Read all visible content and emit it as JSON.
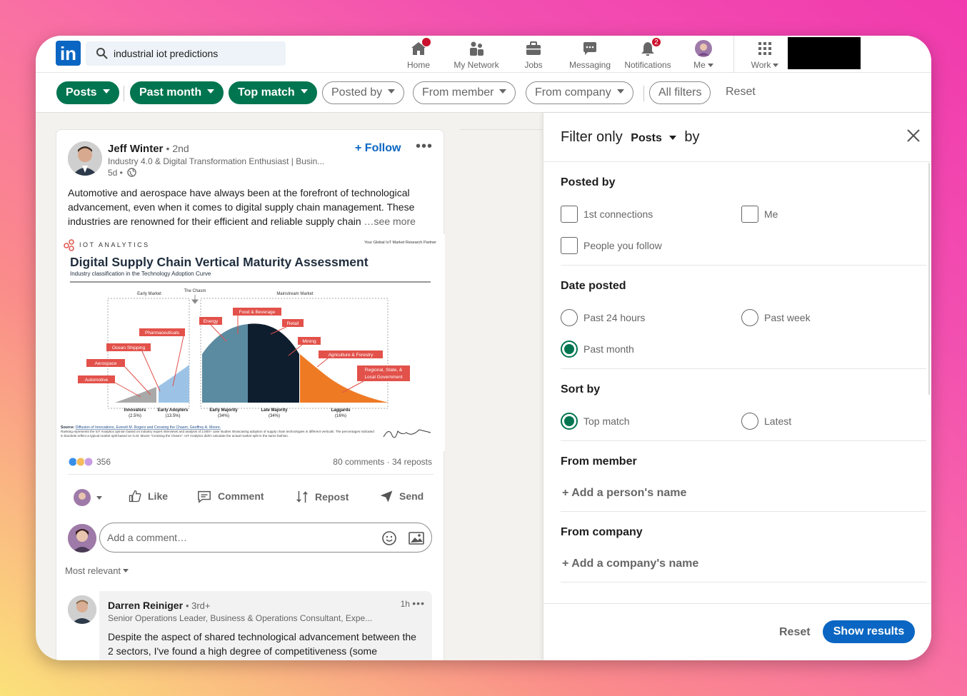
{
  "search": {
    "query": "industrial iot predictions"
  },
  "nav": [
    {
      "label": "Home",
      "badge": ""
    },
    {
      "label": "My Network",
      "badge": ""
    },
    {
      "label": "Jobs",
      "badge": ""
    },
    {
      "label": "Messaging",
      "badge": ""
    },
    {
      "label": "Notifications",
      "badge": "2"
    },
    {
      "label": "Me",
      "badge": ""
    },
    {
      "label": "Work",
      "badge": ""
    }
  ],
  "filters": {
    "posts": "Posts",
    "past_month": "Past month",
    "top_match": "Top match",
    "posted_by": "Posted by",
    "from_member": "From member",
    "from_company": "From company",
    "all_filters": "All filters",
    "reset": "Reset"
  },
  "post": {
    "author": "Jeff Winter",
    "degree": "• 2nd",
    "headline": "Industry 4.0 & Digital Transformation Enthusiast | Busin...",
    "time": "5d •",
    "follow": "+ Follow",
    "body": "Automotive and aerospace have always been at the forefront of technological advancement, even when it comes to digital supply chain management. These industries are renowned for their efficient and reliable supply chain",
    "see_more": "…see more",
    "reaction_count": "356",
    "stats": "80 comments · 34 reposts",
    "actions": {
      "like": "Like",
      "comment": "Comment",
      "repost": "Repost",
      "send": "Send"
    },
    "comment_placeholder": "Add a comment…",
    "sort_label": "Most relevant"
  },
  "image": {
    "brand": "IOT ANALYTICS",
    "tagline": "Your Global IoT Market Research Partner",
    "title": "Digital Supply Chain Vertical Maturity Assessment",
    "subtitle": "Industry classification in the Technology Adoption Curve",
    "early_market": "Early Market",
    "chasm": "The Chasm",
    "mainstream": "Mainstream Market",
    "labels": [
      "Automotive",
      "Aerospace",
      "Ocean Shipping",
      "Pharmaceuticals",
      "Energy",
      "Food & Beverage",
      "Retail",
      "Mining",
      "Agriculture & Forestry",
      "Regional, State, &",
      "Local Government"
    ],
    "segments": [
      "Innovators",
      "(2.5%)",
      "Early Adopters",
      "(13.5%)",
      "Early Majority",
      "(34%)",
      "Late Majority",
      "(34%)",
      "Laggards",
      "(16%)"
    ],
    "source_label": "Source:",
    "source_link": "Diffusion of Innovations, Everett M. Rogers and Crossing the Chasm, Geoffrey A. Moore.",
    "source_note": "Ranking represents the IoT Analytics opinion based on industry expert interviews and analysis of 2,800+ case studies showcasing adoption of supply chain technologies in different verticals. The percentages indicated in brackets reflect a typical market split based on G.M. Moore \"Crossing the Chasm\". IoT Analytics didn't calculate the actual market split in the same fashion."
  },
  "reply": {
    "author": "Darren Reiniger",
    "degree": "• 3rd+",
    "time": "1h",
    "headline": "Senior Operations Leader, Business & Operations Consultant, Expe...",
    "body": "Despite the aspect of shared technological advancement between the 2 sectors, I've found a high degree of competitiveness (some"
  },
  "panel": {
    "filter_only": "Filter only",
    "posts": "Posts",
    "by": "by",
    "posted_by": "Posted by",
    "first_connections": "1st connections",
    "me": "Me",
    "people_you_follow": "People you follow",
    "date_posted": "Date posted",
    "past_24": "Past 24 hours",
    "past_week": "Past week",
    "past_month": "Past month",
    "sort_by": "Sort by",
    "top_match": "Top match",
    "latest": "Latest",
    "from_member": "From member",
    "add_person": "+ Add a person's name",
    "from_company": "From company",
    "add_company": "+ Add a company's name",
    "reset": "Reset",
    "show_results": "Show results"
  },
  "colors": {
    "brand": "#0a66c2",
    "active_filter": "#01754f",
    "notification": "#cb112d"
  }
}
